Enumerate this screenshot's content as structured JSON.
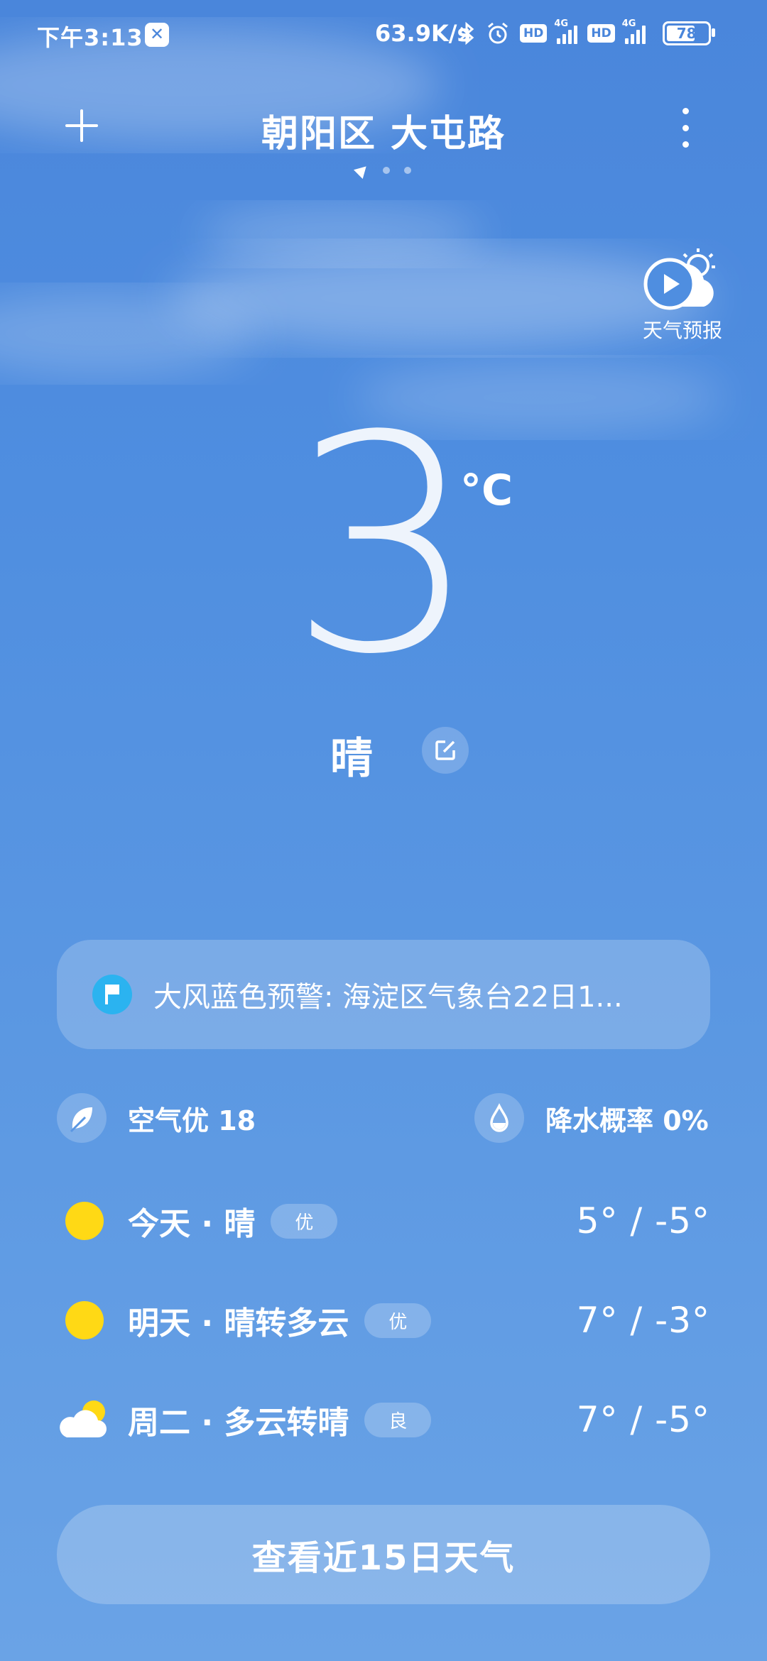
{
  "status_bar": {
    "time": "下午3:13",
    "net_speed": "63.9K/s",
    "hd1": "HD",
    "net1": "4G",
    "hd2": "HD",
    "net2": "4G",
    "battery": "78",
    "battery_level": 0.78
  },
  "header": {
    "location": "朝阳区 大屯路",
    "add_icon": "plus-icon",
    "menu_icon": "more-vertical-icon",
    "page_count": 3
  },
  "forecast_video": {
    "label": "天气预报",
    "icon": "play-cloud-icon"
  },
  "current": {
    "temperature": "3",
    "unit": "°C",
    "condition": "晴",
    "edit_icon": "edit-icon"
  },
  "alert": {
    "text": "大风蓝色预警: 海淀区气象台22日1...",
    "icon": "warning-flag-icon"
  },
  "info": {
    "air_quality": "空气优 18",
    "precipitation": "降水概率 0%"
  },
  "forecast": [
    {
      "day": "今天 · 晴",
      "badge": "优",
      "temp": "5° / -5°",
      "icon": "sun-icon"
    },
    {
      "day": "明天 · 晴转多云",
      "badge": "优",
      "temp": "7° / -3°",
      "icon": "sun-icon"
    },
    {
      "day": "周二 · 多云转晴",
      "badge": "良",
      "temp": "7° / -5°",
      "icon": "cloud-sun-icon"
    }
  ],
  "bottom_button": "查看近15日天气",
  "colors": {
    "sky_top": "#4a86db",
    "sky_bottom": "#6aa3e6",
    "sun": "#ffd915",
    "alert_icon": "#2bb3f0"
  }
}
